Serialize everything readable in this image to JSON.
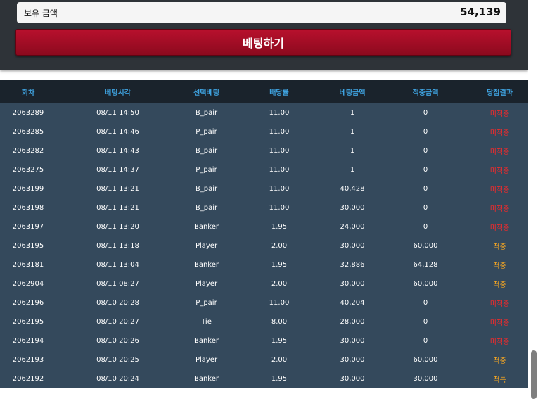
{
  "balance": {
    "label": "보유 금액",
    "value": "54,139"
  },
  "bet_button": {
    "label": "베팅하기"
  },
  "history": {
    "columns": [
      "회차",
      "베팅시각",
      "선택베팅",
      "배당률",
      "베팅금액",
      "적중금액",
      "당첨결과"
    ],
    "rows": [
      [
        "2063289",
        "08/11 14:50",
        "B_pair",
        "11.00",
        "1",
        "0",
        "미적중"
      ],
      [
        "2063285",
        "08/11 14:46",
        "P_pair",
        "11.00",
        "1",
        "0",
        "미적중"
      ],
      [
        "2063282",
        "08/11 14:43",
        "B_pair",
        "11.00",
        "1",
        "0",
        "미적중"
      ],
      [
        "2063275",
        "08/11 14:37",
        "P_pair",
        "11.00",
        "1",
        "0",
        "미적중"
      ],
      [
        "2063199",
        "08/11 13:21",
        "B_pair",
        "11.00",
        "40,428",
        "0",
        "미적중"
      ],
      [
        "2063198",
        "08/11 13:21",
        "B_pair",
        "11.00",
        "30,000",
        "0",
        "미적중"
      ],
      [
        "2063197",
        "08/11 13:20",
        "Banker",
        "1.95",
        "24,000",
        "0",
        "미적중"
      ],
      [
        "2063195",
        "08/11 13:18",
        "Player",
        "2.00",
        "30,000",
        "60,000",
        "적중"
      ],
      [
        "2063181",
        "08/11 13:04",
        "Banker",
        "1.95",
        "32,886",
        "64,128",
        "적중"
      ],
      [
        "2062904",
        "08/11 08:27",
        "Player",
        "2.00",
        "30,000",
        "60,000",
        "적중"
      ],
      [
        "2062196",
        "08/10 20:28",
        "P_pair",
        "11.00",
        "40,204",
        "0",
        "미적중"
      ],
      [
        "2062195",
        "08/10 20:27",
        "Tie",
        "8.00",
        "28,000",
        "0",
        "미적중"
      ],
      [
        "2062194",
        "08/10 20:26",
        "Banker",
        "1.95",
        "30,000",
        "0",
        "미적중"
      ],
      [
        "2062193",
        "08/10 20:25",
        "Player",
        "2.00",
        "30,000",
        "60,000",
        "적중"
      ],
      [
        "2062192",
        "08/10 20:24",
        "Banker",
        "1.95",
        "30,000",
        "30,000",
        "적특"
      ]
    ]
  },
  "colors": {
    "header_text": "#3fa3e0",
    "row_bg": "#34495c",
    "lose": "#ff2828",
    "win": "#f5a623",
    "button": "#b8102d"
  }
}
